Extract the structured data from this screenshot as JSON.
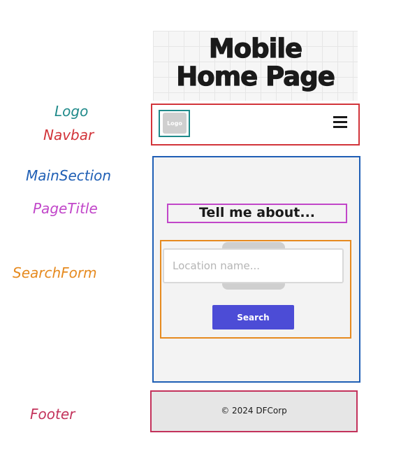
{
  "title": {
    "line1": "Mobile",
    "line2": "Home Page"
  },
  "labels": {
    "logo": "Logo",
    "navbar": "Navbar",
    "main_section": "MainSection",
    "page_title": "PageTitle",
    "search_form": "SearchForm",
    "footer": "Footer"
  },
  "navbar": {
    "logo_text": "Logo",
    "menu_icon": "hamburger-menu-icon"
  },
  "main": {
    "page_title": "Tell me about...",
    "search_placeholder": "Location name...",
    "search_button": "Search"
  },
  "footer": {
    "text": "© 2024 DFCorp"
  },
  "colors": {
    "logo_label": "#1f8a8a",
    "navbar": "#d2343a",
    "main_section": "#1f5fb5",
    "page_title": "#c146c9",
    "search_form": "#e68a1f",
    "footer": "#c3325b",
    "search_button": "#4c4cd6"
  }
}
